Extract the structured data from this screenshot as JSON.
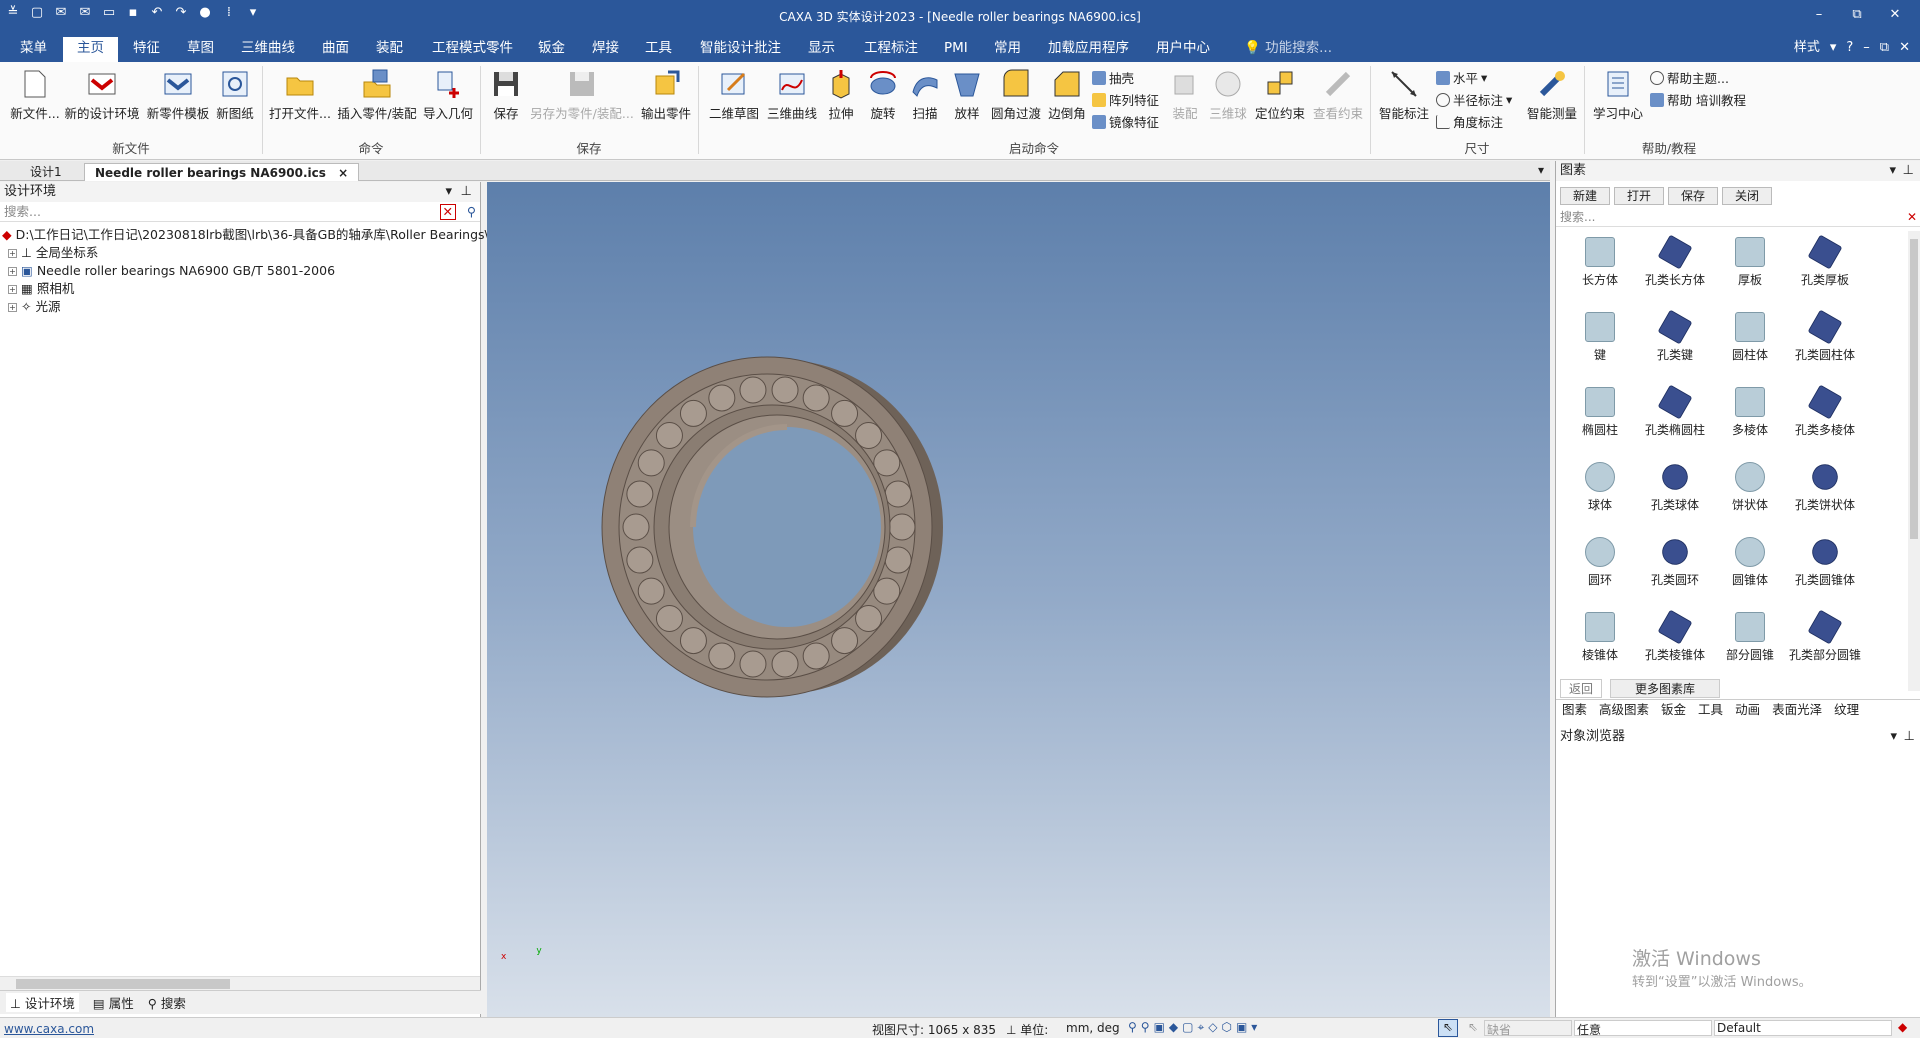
{
  "window": {
    "title": "CAXA 3D 实体设计2023 - [Needle roller bearings NA6900.ics]",
    "controls": [
      "–",
      "⧉",
      "✕"
    ]
  },
  "menu": {
    "tabs": [
      "菜单",
      "主页",
      "特征",
      "草图",
      "三维曲线",
      "曲面",
      "装配",
      "工程模式零件",
      "钣金",
      "焊接",
      "工具",
      "智能设计批注",
      "显示",
      "工程标注",
      "PMI",
      "常用",
      "加载应用程序",
      "用户中心"
    ],
    "active": "主页",
    "search": "功能搜索...",
    "style": "样式"
  },
  "ribbon": {
    "buttons": [
      {
        "label": "新文件...",
        "icon": "new-file-icon"
      },
      {
        "label": "新的设计环境",
        "icon": "new-design-env-icon"
      },
      {
        "label": "新零件模板",
        "icon": "new-part-template-icon"
      },
      {
        "label": "新图纸",
        "icon": "new-drawing-icon"
      },
      {
        "label": "打开文件...",
        "icon": "open-file-icon"
      },
      {
        "label": "插入零件/装配",
        "icon": "insert-part-icon"
      },
      {
        "label": "导入几何",
        "icon": "import-geometry-icon"
      },
      {
        "label": "保存",
        "icon": "save-icon"
      },
      {
        "label": "另存为零件/装配...",
        "icon": "save-as-icon"
      },
      {
        "label": "输出零件",
        "icon": "export-part-icon"
      },
      {
        "label": "二维草图",
        "icon": "sketch-2d-icon"
      },
      {
        "label": "三维曲线",
        "icon": "curve-3d-icon"
      },
      {
        "label": "拉伸",
        "icon": "extrude-icon"
      },
      {
        "label": "旋转",
        "icon": "revolve-icon"
      },
      {
        "label": "扫描",
        "icon": "sweep-icon"
      },
      {
        "label": "放样",
        "icon": "loft-icon"
      },
      {
        "label": "圆角过渡",
        "icon": "fillet-icon"
      },
      {
        "label": "边倒角",
        "icon": "chamfer-icon"
      },
      {
        "label": "装配",
        "icon": "assembly-icon"
      },
      {
        "label": "三维球",
        "icon": "3d-ball-icon"
      },
      {
        "label": "定位约束",
        "icon": "position-constraint-icon"
      },
      {
        "label": "查看约束",
        "icon": "view-constraint-icon"
      },
      {
        "label": "智能标注",
        "icon": "smart-dimension-icon"
      },
      {
        "label": "智能测量",
        "icon": "smart-measure-icon"
      },
      {
        "label": "学习中心",
        "icon": "learning-center-icon"
      }
    ],
    "small": [
      {
        "label": "抽壳",
        "icon": "shell-icon"
      },
      {
        "label": "阵列特征",
        "icon": "pattern-icon"
      },
      {
        "label": "镜像特征",
        "icon": "mirror-icon"
      },
      {
        "label": "水平",
        "icon": "horizontal-dim-icon"
      },
      {
        "label": "半径标注",
        "icon": "radius-dim-icon"
      },
      {
        "label": "角度标注",
        "icon": "angle-dim-icon"
      },
      {
        "label": "帮助主题...",
        "icon": "help-topic-icon"
      },
      {
        "label": "帮助 培训教程",
        "icon": "help-training-icon"
      }
    ],
    "groups": [
      "新文件",
      "命令",
      "保存",
      "启动命令",
      "尺寸",
      "帮助/教程"
    ]
  },
  "doctabs": [
    "设计1",
    "Needle roller bearings NA6900.ics"
  ],
  "left": {
    "title": "设计环境",
    "search": "搜索...",
    "tree": [
      "D:\\工作日记\\工作日记\\20230818lrb截图\\lrb\\36-具备GB的轴承库\\Roller Bearings\\",
      "全局坐标系",
      "Needle roller bearings NA6900 GB/T 5801-2006",
      "照相机",
      "光源"
    ],
    "footer": [
      "设计环境",
      "属性",
      "搜索"
    ]
  },
  "right": {
    "title": "图素",
    "toolbar": [
      "新建",
      "打开",
      "保存",
      "关闭"
    ],
    "search": "搜索...",
    "items": [
      "长方体",
      "孔类长方体",
      "厚板",
      "孔类厚板",
      "键",
      "孔类键",
      "圆柱体",
      "孔类圆柱体",
      "椭圆柱",
      "孔类椭圆柱",
      "多棱体",
      "孔类多棱体",
      "球体",
      "孔类球体",
      "饼状体",
      "孔类饼状体",
      "圆环",
      "孔类圆环",
      "圆锥体",
      "孔类圆锥体",
      "棱锥体",
      "孔类棱锥体",
      "部分圆锥",
      "孔类部分圆锥"
    ],
    "back": "返回",
    "more": "更多图素库",
    "tabs": [
      "图素",
      "高级图素",
      "钣金",
      "工具",
      "动画",
      "表面光泽",
      "纹理"
    ],
    "browser": "对象浏览器"
  },
  "status": {
    "link": "www.caxa.com",
    "viewsize": "视图尺寸: 1065 x  835",
    "unit_label": "单位:",
    "unit": "mm, deg",
    "default_sel": "缺省",
    "any": "任意",
    "default": "Default"
  },
  "watermark": {
    "line1": "激活 Windows",
    "line2": "转到“设置”以激活 Windows。"
  }
}
